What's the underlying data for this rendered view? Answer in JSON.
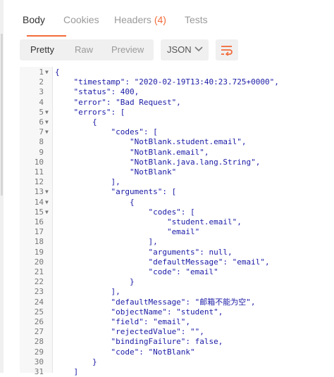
{
  "tabs": [
    {
      "label": "Body",
      "count": ""
    },
    {
      "label": "Cookies",
      "count": ""
    },
    {
      "label": "Headers",
      "count": "(4)"
    },
    {
      "label": "Tests",
      "count": ""
    }
  ],
  "view_modes": [
    "Pretty",
    "Raw",
    "Preview"
  ],
  "selected_view": "Pretty",
  "language": {
    "selected": "JSON"
  },
  "icons": {
    "format": "wrap-lines-icon",
    "dropdown": "chevron-down-icon"
  },
  "colors": {
    "accent": "#f26b3a",
    "json_text": "#1a1aa6"
  },
  "code_lines": [
    "{",
    "    \"timestamp\": \"2020-02-19T13:40:23.725+0000\",",
    "    \"status\": 400,",
    "    \"error\": \"Bad Request\",",
    "    \"errors\": [",
    "        {",
    "            \"codes\": [",
    "                \"NotBlank.student.email\",",
    "                \"NotBlank.email\",",
    "                \"NotBlank.java.lang.String\",",
    "                \"NotBlank\"",
    "            ],",
    "            \"arguments\": [",
    "                {",
    "                    \"codes\": [",
    "                        \"student.email\",",
    "                        \"email\"",
    "                    ],",
    "                    \"arguments\": null,",
    "                    \"defaultMessage\": \"email\",",
    "                    \"code\": \"email\"",
    "                }",
    "            ],",
    "            \"defaultMessage\": \"邮箱不能为空\",",
    "            \"objectName\": \"student\",",
    "            \"field\": \"email\",",
    "            \"rejectedValue\": \"\",",
    "            \"bindingFailure\": false,",
    "            \"code\": \"NotBlank\"",
    "        }",
    "    ]"
  ],
  "line_numbers": [
    "1",
    "2",
    "3",
    "4",
    "5",
    "6",
    "7",
    "8",
    "9",
    "10",
    "11",
    "12",
    "13",
    "14",
    "15",
    "16",
    "17",
    "18",
    "19",
    "20",
    "21",
    "22",
    "23",
    "24",
    "25",
    "26",
    "27",
    "28",
    "29",
    "30",
    "31"
  ],
  "foldable_lines": [
    1,
    5,
    6,
    7,
    13,
    14,
    15
  ]
}
